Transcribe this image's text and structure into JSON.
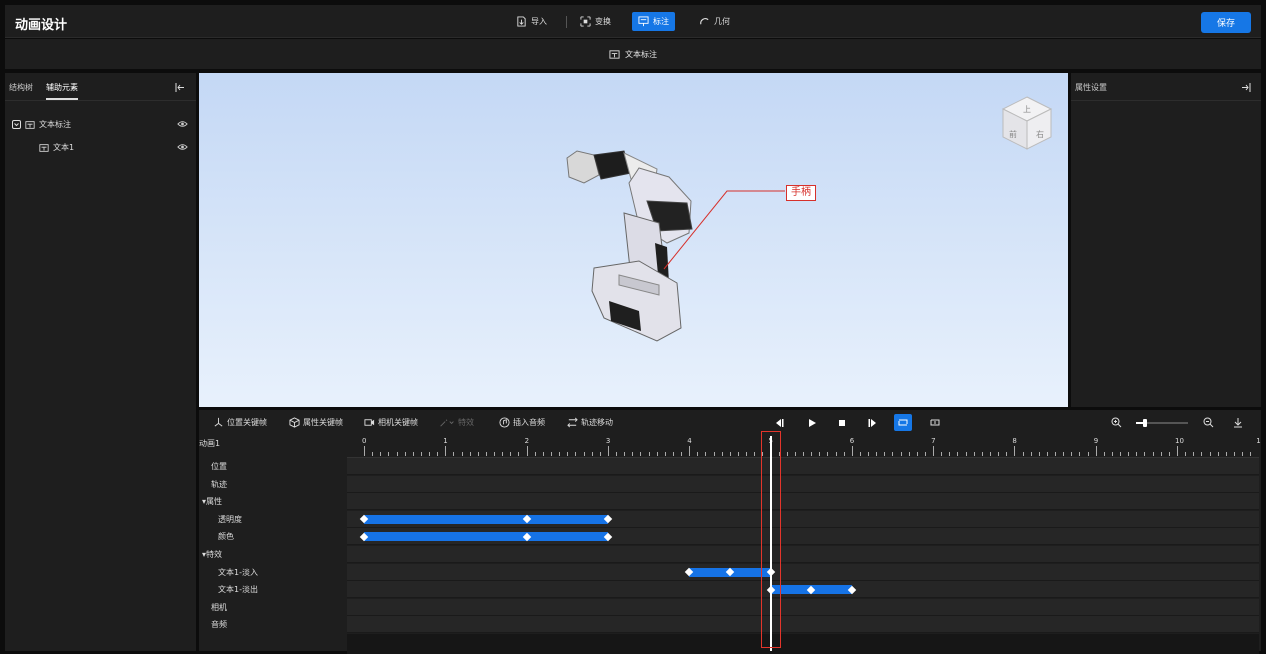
{
  "app": {
    "title": "动画设计",
    "save": "保存"
  },
  "toolbar": {
    "import": "导入",
    "transform": "变换",
    "annotate": "标注",
    "geometry": "几何"
  },
  "subbar": {
    "label": "文本标注"
  },
  "left_panel": {
    "tabs": [
      "结构树",
      "辅助元素"
    ],
    "tree": {
      "root": "文本标注",
      "child": "文本1"
    }
  },
  "right_panel": {
    "title": "属性设置"
  },
  "viewport": {
    "callout": "手柄",
    "cube": {
      "top": "上",
      "front": "前",
      "right": "右"
    }
  },
  "timeline_toolbar": {
    "pos_keyframe": "位置关键帧",
    "attr_keyframe": "属性关键帧",
    "camera_keyframe": "相机关键帧",
    "effect": "特效",
    "insert_audio": "插入音频",
    "track_move": "轨迹移动",
    "zoom_level": 0.18
  },
  "timeline": {
    "name": "动画1",
    "tick_labels": [
      "0",
      "1",
      "2",
      "3",
      "4",
      "5",
      "6",
      "7",
      "8",
      "9",
      "10",
      "1"
    ],
    "playhead": 5,
    "rows": [
      {
        "label": "位置"
      },
      {
        "label": "轨迹"
      },
      {
        "label": "▾属性"
      },
      {
        "label": "透明度",
        "bar": [
          0,
          3
        ],
        "keys": [
          0,
          2,
          3
        ]
      },
      {
        "label": "颜色",
        "bar": [
          0,
          3
        ],
        "keys": [
          0,
          2,
          3
        ]
      },
      {
        "label": "▾特效"
      },
      {
        "label": "文本1-淡入",
        "bar": [
          4,
          5
        ],
        "keys": [
          4,
          4.5,
          5
        ]
      },
      {
        "label": "文本1-淡出",
        "bar": [
          5,
          6
        ],
        "keys": [
          5,
          5.5,
          6
        ]
      },
      {
        "label": "相机"
      },
      {
        "label": "音频"
      }
    ]
  }
}
